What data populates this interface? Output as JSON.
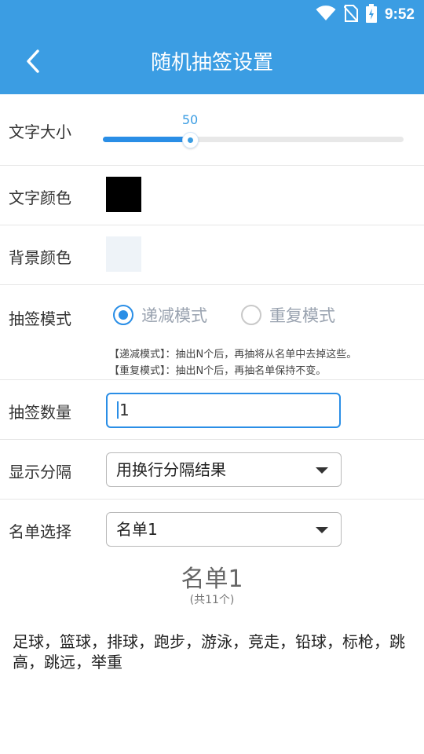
{
  "status_bar": {
    "time": "9:52",
    "icons": [
      "wifi-icon",
      "no-sim-icon",
      "battery-charging-icon"
    ]
  },
  "header": {
    "title": "随机抽签设置",
    "back_icon": "chevron-left-icon"
  },
  "font_size": {
    "label": "文字大小",
    "value": "50",
    "fraction": 0.29
  },
  "text_color": {
    "label": "文字颜色",
    "color": "#000000"
  },
  "bg_color": {
    "label": "背景颜色",
    "color": "#eef3f8"
  },
  "draw_mode": {
    "label": "抽签模式",
    "options": [
      {
        "label": "递减模式",
        "selected": true
      },
      {
        "label": "重复模式",
        "selected": false
      }
    ],
    "notes": [
      "【递减模式】：抽出N个后，再抽将从名单中去掉这些。",
      "【重复模式】：抽出N个后，再抽名单保持不变。"
    ]
  },
  "draw_count": {
    "label": "抽签数量",
    "value": "1"
  },
  "separator": {
    "label": "显示分隔",
    "selected": "用换行分隔结果"
  },
  "list_select": {
    "label": "名单选择",
    "selected": "名单1"
  },
  "list_preview": {
    "name": "名单1",
    "count": "(共11个)",
    "items": "足球，篮球，排球，跑步，游泳，竞走，铅球，标枪，跳高，跳远，举重"
  },
  "colors": {
    "accent": "#3b9de3",
    "active": "#2a8ee6"
  }
}
